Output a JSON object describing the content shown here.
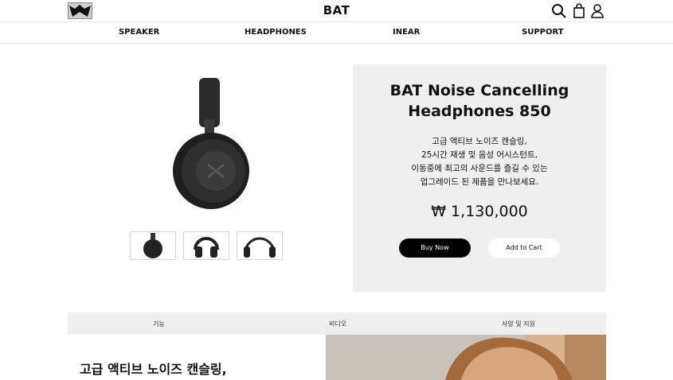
{
  "header": {
    "brand": "BAT",
    "icons": [
      "search-icon",
      "shopping-bag-icon",
      "user-icon"
    ]
  },
  "nav": {
    "items": [
      "SPEAKER",
      "HEADPHONES",
      "INEAR",
      "SUPPORT"
    ]
  },
  "product": {
    "title_line1": "BAT Noise Cancelling",
    "title_line2": "Headphones 850",
    "desc_line1": "고급 액티브 노이즈 캔슬링,",
    "desc_line2": "25시간 재생 및 음성 어시스턴트,",
    "desc_line3": "이동중에 최고의 사운드를 즐길 수 있는",
    "desc_line4": "업그레이드 된 제품을 만나보세요.",
    "price": "₩ 1,130,000",
    "buy_label": "Buy Now",
    "cart_label": "Add to Cart"
  },
  "tabs": [
    "기능",
    "비디오",
    "사양 및 지원"
  ],
  "lower": {
    "heading": "고급 액티브 노이즈 캔슬링,"
  },
  "colors": {
    "panel_bg": "#efefef",
    "primary_button": "#000000"
  }
}
